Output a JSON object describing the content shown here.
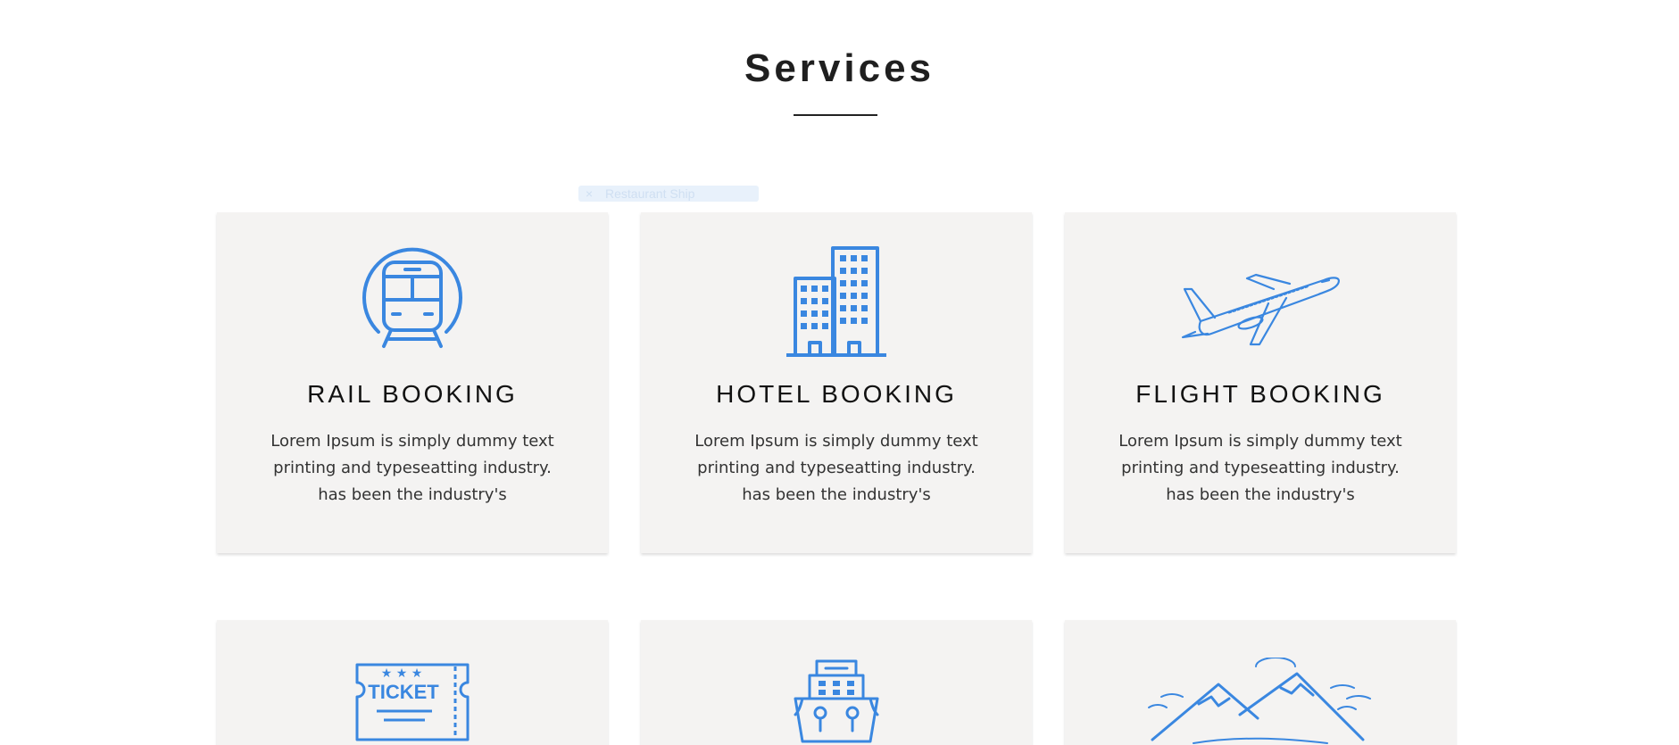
{
  "section": {
    "title": "Services"
  },
  "ghost_tooltip": {
    "close": "×",
    "label": "Restaurant Ship"
  },
  "services": [
    {
      "title": "RAIL BOOKING",
      "icon": "train-icon",
      "desc": [
        "Lorem Ipsum is simply dummy text",
        "printing and typeseatting industry.",
        "has been the industry's"
      ]
    },
    {
      "title": "HOTEL BOOKING",
      "icon": "hotel-building-icon",
      "desc": [
        "Lorem Ipsum is simply dummy text",
        "printing and typeseatting industry.",
        "has been the industry's"
      ]
    },
    {
      "title": "FLIGHT BOOKING",
      "icon": "airplane-icon",
      "desc": [
        "Lorem Ipsum is simply dummy text",
        "printing and typeseatting industry.",
        "has been the industry's"
      ]
    },
    {
      "title": "",
      "icon": "ticket-icon",
      "icon_text": "TICKET",
      "desc": []
    },
    {
      "title": "",
      "icon": "cruise-ship-icon",
      "desc": []
    },
    {
      "title": "",
      "icon": "mountains-icon",
      "desc": []
    }
  ],
  "colors": {
    "accent": "#3a87e0",
    "card_bg": "#f4f3f2",
    "title": "#1f1f1f"
  }
}
